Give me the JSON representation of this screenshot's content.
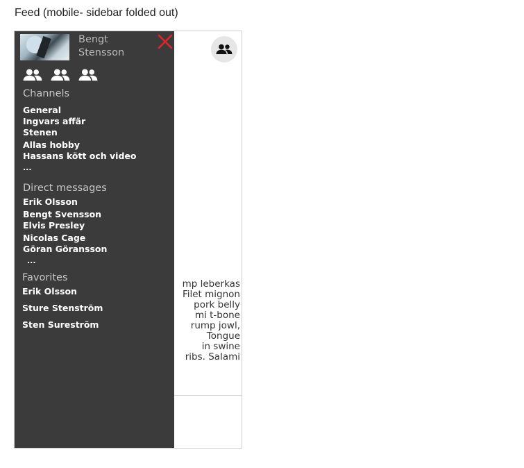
{
  "page": {
    "caption": "Feed (mobile- sidebar folded out)"
  },
  "feed": {
    "text_lines": [
      "mp leberkas",
      "Filet mignon",
      "pork belly",
      "mi t-bone",
      "rump jowl,",
      "Tongue",
      "in swine",
      "ribs. Salami"
    ],
    "top_right_icon": "group-icon"
  },
  "sidebar": {
    "background": "#3b3b3b",
    "profile": {
      "first_name": "Bengt",
      "last_name": "Stensson",
      "close_icon": "close-icon",
      "close_color": "#e0262b"
    },
    "icon_row": [
      "group-icon",
      "group-icon",
      "group-icon"
    ],
    "channels": {
      "title": "Channels",
      "items": [
        "General",
        "Ingvars affär",
        "Stenen",
        "Allas hobby",
        "Hassans kött och video"
      ],
      "more": "..."
    },
    "direct_messages": {
      "title": "Direct messages",
      "items": [
        "Erik Olsson",
        "Bengt Svensson",
        "Elvis Presley",
        "Nicolas Cage",
        "Göran Göransson"
      ],
      "more": "..."
    },
    "favorites": {
      "title": "Favorites",
      "items": [
        "Erik Olsson",
        "Sture Stenström",
        "Sten Sureström"
      ]
    }
  }
}
